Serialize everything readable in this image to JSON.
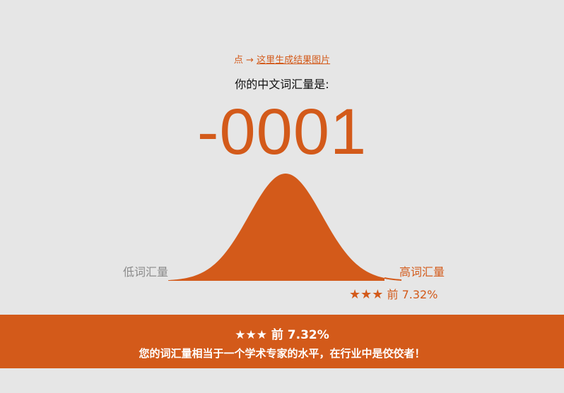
{
  "header": {
    "prompt_prefix": "点 → ",
    "generate_link": "这里生成结果图片",
    "result_label": "你的中文词汇量是:"
  },
  "result": {
    "score": "-0001"
  },
  "distribution": {
    "low_label": "低词汇量",
    "high_label": "高词汇量",
    "stars": "★★★",
    "rank": "前 7.32%",
    "percentile": 7.32,
    "color": "#d35a1a"
  },
  "banner": {
    "stars": "★★★",
    "rank": "前 7.32%",
    "message": "您的词汇量相当于一个学术专家的水平，在行业中是佼佼者！",
    "color": "#d35a1a"
  }
}
